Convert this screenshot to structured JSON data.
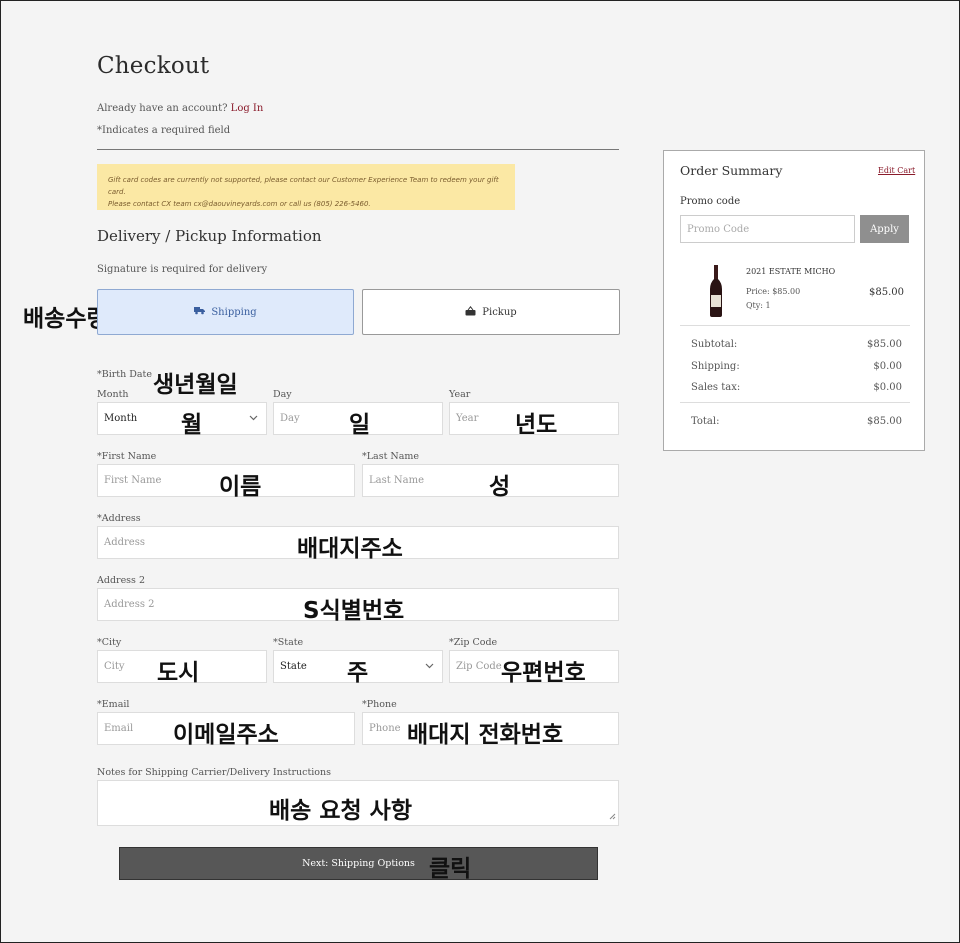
{
  "page": {
    "title": "Checkout",
    "account_prompt": "Already have an account?",
    "login_link": "Log In",
    "required_note": "*Indicates a required field"
  },
  "notice": {
    "line1": "Gift card codes are currently not supported, please contact our Customer Experience Team to redeem your gift card.",
    "line2": "Please contact CX team cx@daouvineyards.com or call us (805) 226-5460."
  },
  "delivery": {
    "section_title": "Delivery / Pickup Information",
    "signature_note": "Signature is required for delivery",
    "shipping_label": "Shipping",
    "pickup_label": "Pickup"
  },
  "form": {
    "birth_date_label": "*Birth Date",
    "month_label": "Month",
    "month_value": "Month",
    "day_label": "Day",
    "day_placeholder": "Day",
    "year_label": "Year",
    "year_placeholder": "Year",
    "first_name_label": "*First Name",
    "first_name_placeholder": "First Name",
    "last_name_label": "*Last Name",
    "last_name_placeholder": "Last Name",
    "address_label": "*Address",
    "address_placeholder": "Address",
    "address2_label": "Address 2",
    "address2_placeholder": "Address 2",
    "city_label": "*City",
    "city_placeholder": "City",
    "state_label": "*State",
    "state_value": "State",
    "zip_label": "*Zip Code",
    "zip_placeholder": "Zip Code",
    "email_label": "*Email",
    "email_placeholder": "Email",
    "phone_label": "*Phone",
    "phone_placeholder": "Phone",
    "notes_label": "Notes for Shipping Carrier/Delivery Instructions",
    "next_button": "Next: Shipping Options"
  },
  "annotations": {
    "shipping_select": "배송수령(선택)",
    "birth_date": "생년월일",
    "month": "월",
    "day": "일",
    "year": "년도",
    "first_name": "이름",
    "last_name": "성",
    "address": "배대지주소",
    "address2": "S식별번호",
    "city": "도시",
    "state": "주",
    "zip": "우편번호",
    "email": "이메일주소",
    "phone": "배대지 전화번호",
    "notes": "배송 요청 사항",
    "click": "클릭"
  },
  "summary": {
    "title": "Order Summary",
    "edit_cart": "Edit Cart",
    "promo_label": "Promo code",
    "promo_placeholder": "Promo Code",
    "apply_label": "Apply",
    "item_name": "2021 ESTATE MICHO",
    "item_price": "Price: $85.00",
    "item_qty": "Qty: 1",
    "item_total": "$85.00",
    "subtotal_label": "Subtotal:",
    "subtotal_value": "$85.00",
    "shipping_label": "Shipping:",
    "shipping_value": "$0.00",
    "tax_label": "Sales tax:",
    "tax_value": "$0.00",
    "total_label": "Total:",
    "total_value": "$85.00"
  }
}
